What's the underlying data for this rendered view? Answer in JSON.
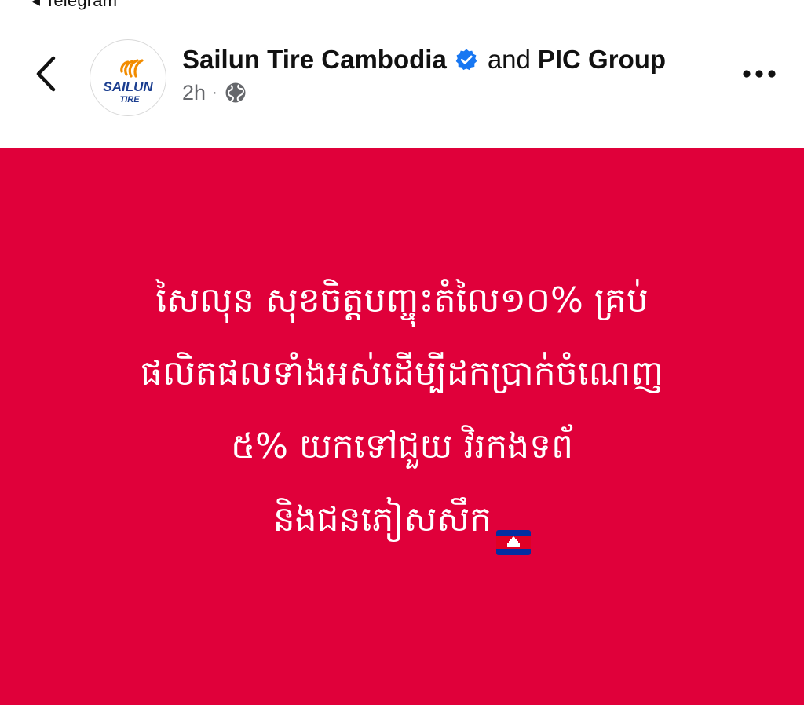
{
  "status_bar": {
    "back_app_label": "◂ Telegram"
  },
  "post_header": {
    "page_name": "Sailun Tire Cambodia",
    "and_text": "and",
    "coauthor_name": "PIC Group",
    "time": "2h",
    "separator": "·",
    "avatar_logo_text": "SAILUN",
    "avatar_logo_subtext": "TIRE"
  },
  "post_image": {
    "background_color": "#e0003a",
    "lines": [
      "សៃលុន សុខចិត្តបញ្ចុះតំលៃ១០% គ្រប់",
      "ផលិតផលទាំងអស់ដើម្បីដកប្រាក់ចំណេញ",
      "៥% យកទៅជួយ វិរកងទព័",
      "និងជនភៀសសឹក"
    ]
  },
  "icons": {
    "back": "chevron-left-icon",
    "verified": "verified-badge-icon",
    "audience": "globe-icon",
    "more": "more-horizontal-icon",
    "flag": "cambodia-flag-icon"
  }
}
